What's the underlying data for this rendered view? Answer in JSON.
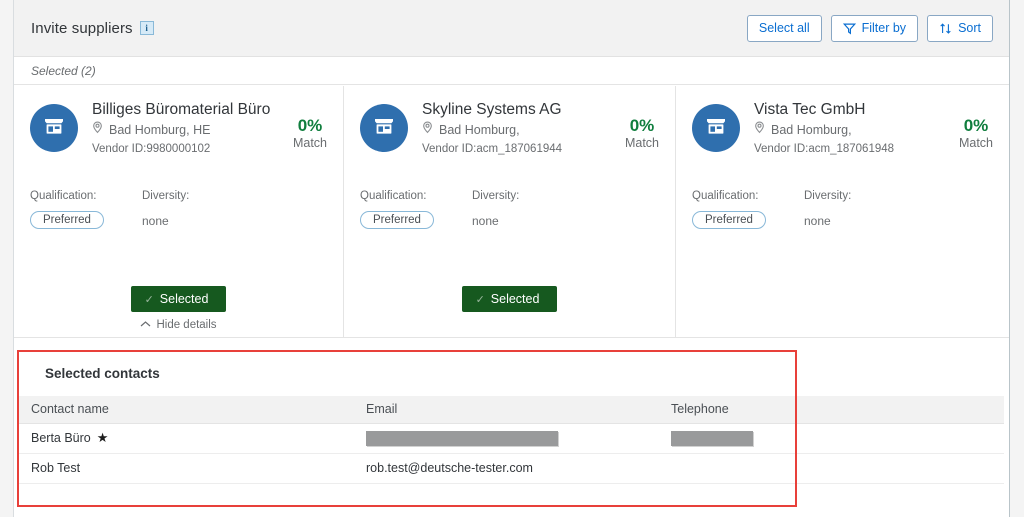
{
  "header": {
    "title": "Invite suppliers",
    "info_icon": "info-icon",
    "actions": [
      {
        "label": "Select all",
        "icon": ""
      },
      {
        "label": "Filter by",
        "icon": "filter-icon"
      },
      {
        "label": "Sort",
        "icon": "sort-icon"
      }
    ]
  },
  "selected_bar": {
    "text": "Selected (2)"
  },
  "cards": [
    {
      "avatar_icon": "storefront-icon",
      "name": "Billiges Büromaterial Büro",
      "location": "Bad Homburg, HE",
      "location_icon": "location-pin-icon",
      "vendor_id": "Vendor ID:9980000102",
      "match_pct": "0%",
      "match_label": "Match",
      "qualification_label": "Qualification:",
      "qualification_value": "Preferred",
      "diversity_label": "Diversity:",
      "diversity_value": "none",
      "button_label": "Selected",
      "details_label": "Hide details",
      "has_details_toggle": true
    },
    {
      "avatar_icon": "storefront-icon",
      "name": "Skyline Systems AG",
      "location": "Bad Homburg,",
      "location_icon": "location-pin-icon",
      "vendor_id": "Vendor ID:acm_187061944",
      "match_pct": "0%",
      "match_label": "Match",
      "qualification_label": "Qualification:",
      "qualification_value": "Preferred",
      "diversity_label": "Diversity:",
      "diversity_value": "none",
      "button_label": "Selected",
      "details_label": "",
      "has_details_toggle": false
    },
    {
      "avatar_icon": "storefront-icon",
      "name": "Vista Tec GmbH",
      "location": "Bad Homburg,",
      "location_icon": "location-pin-icon",
      "vendor_id": "Vendor ID:acm_187061948",
      "match_pct": "0%",
      "match_label": "Match",
      "qualification_label": "Qualification:",
      "qualification_value": "Preferred",
      "diversity_label": "Diversity:",
      "diversity_value": "none",
      "button_label": "",
      "details_label": "",
      "has_details_toggle": false
    }
  ],
  "contacts": {
    "title": "Selected contacts",
    "columns": [
      "Contact name",
      "Email",
      "Telephone"
    ],
    "rows": [
      {
        "name": "Berta Büro",
        "starred": true,
        "email": "",
        "email_redacted": true,
        "telephone": "",
        "telephone_redacted": true
      },
      {
        "name": "Rob Test",
        "starred": false,
        "email": "rob.test@deutsche-tester.com",
        "email_redacted": false,
        "telephone": "",
        "telephone_redacted": false
      }
    ]
  },
  "colors": {
    "accent_blue": "#0a6ed1",
    "avatar_blue": "#2f6fae",
    "selected_green": "#16591f",
    "match_green": "#107e3e",
    "highlight_red": "#e8403a",
    "header_bg": "#f2f2f2"
  }
}
